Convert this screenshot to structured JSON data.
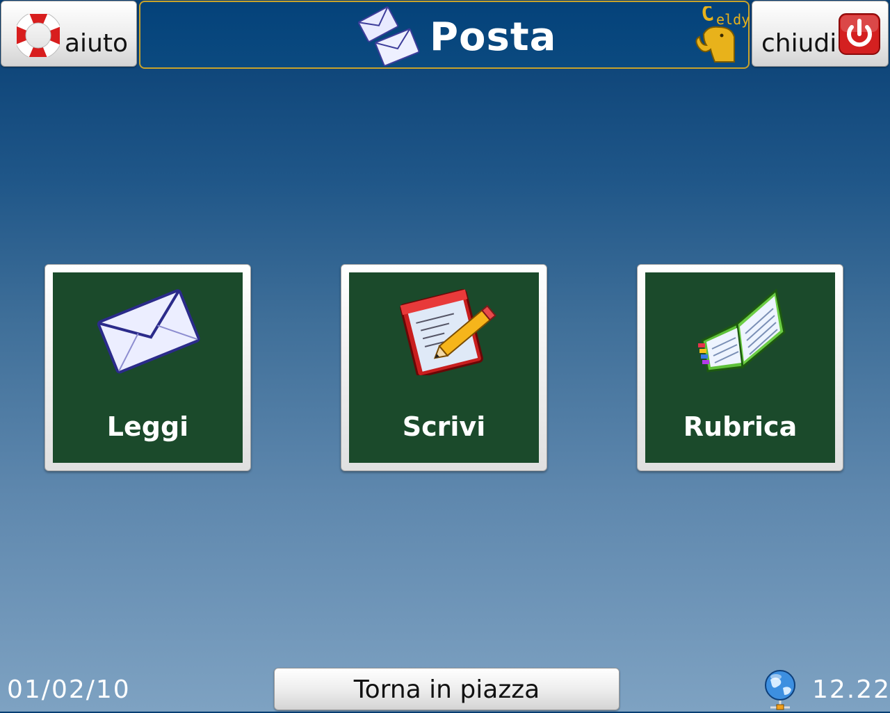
{
  "header": {
    "title": "Posta",
    "help_label": "aiuto",
    "close_label": "chiudi",
    "logo_text": "eldy"
  },
  "main": {
    "tiles": [
      {
        "label": "Leggi",
        "icon": "envelope-icon"
      },
      {
        "label": "Scrivi",
        "icon": "notepad-pencil-icon"
      },
      {
        "label": "Rubrica",
        "icon": "address-book-icon"
      }
    ]
  },
  "footer": {
    "date": "01/02/10",
    "home_label": "Torna in piazza",
    "time": "12.22",
    "network_icon": "globe-network-icon"
  },
  "colors": {
    "tile_background": "#1b4a2b",
    "title_bar": "#04427a",
    "title_border": "#c9a32a",
    "close_red": "#d42020"
  }
}
